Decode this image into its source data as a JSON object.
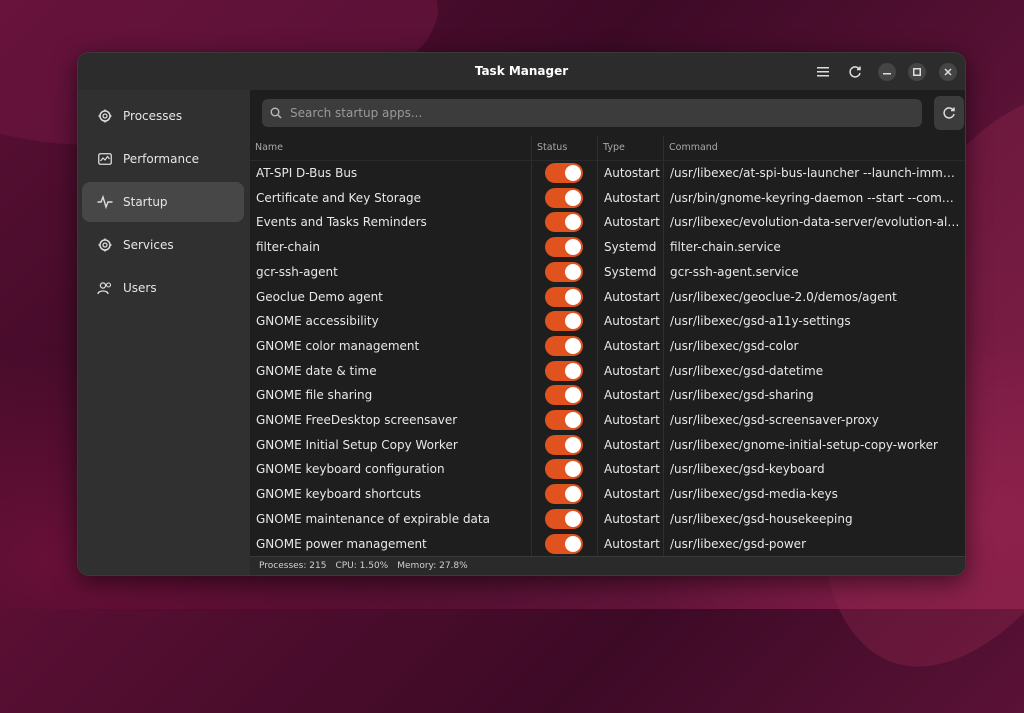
{
  "window": {
    "title": "Task Manager"
  },
  "sidebar": {
    "items": [
      {
        "label": "Processes",
        "icon": "gear-icon",
        "active": false
      },
      {
        "label": "Performance",
        "icon": "chart-icon",
        "active": false
      },
      {
        "label": "Startup",
        "icon": "startup-icon",
        "active": true
      },
      {
        "label": "Services",
        "icon": "gear-icon",
        "active": false
      },
      {
        "label": "Users",
        "icon": "users-icon",
        "active": false
      }
    ]
  },
  "search": {
    "placeholder": "Search startup apps..."
  },
  "table": {
    "columns": [
      "Name",
      "Status",
      "Type",
      "Command"
    ],
    "rows": [
      {
        "name": "AT-SPI D-Bus Bus",
        "enabled": true,
        "type": "Autostart",
        "command": "/usr/libexec/at-spi-bus-launcher --launch-immediately"
      },
      {
        "name": "Certificate and Key Storage",
        "enabled": true,
        "type": "Autostart",
        "command": "/usr/bin/gnome-keyring-daemon --start --compone…"
      },
      {
        "name": "Events and Tasks Reminders",
        "enabled": true,
        "type": "Autostart",
        "command": "/usr/libexec/evolution-data-server/evolution-alarm-…"
      },
      {
        "name": "filter-chain",
        "enabled": true,
        "type": "Systemd",
        "command": "filter-chain.service"
      },
      {
        "name": "gcr-ssh-agent",
        "enabled": true,
        "type": "Systemd",
        "command": "gcr-ssh-agent.service"
      },
      {
        "name": "Geoclue Demo agent",
        "enabled": true,
        "type": "Autostart",
        "command": "/usr/libexec/geoclue-2.0/demos/agent"
      },
      {
        "name": "GNOME accessibility",
        "enabled": true,
        "type": "Autostart",
        "command": "/usr/libexec/gsd-a11y-settings"
      },
      {
        "name": "GNOME color management",
        "enabled": true,
        "type": "Autostart",
        "command": "/usr/libexec/gsd-color"
      },
      {
        "name": "GNOME date & time",
        "enabled": true,
        "type": "Autostart",
        "command": "/usr/libexec/gsd-datetime"
      },
      {
        "name": "GNOME file sharing",
        "enabled": true,
        "type": "Autostart",
        "command": "/usr/libexec/gsd-sharing"
      },
      {
        "name": "GNOME FreeDesktop screensaver",
        "enabled": true,
        "type": "Autostart",
        "command": "/usr/libexec/gsd-screensaver-proxy"
      },
      {
        "name": "GNOME Initial Setup Copy Worker",
        "enabled": true,
        "type": "Autostart",
        "command": "/usr/libexec/gnome-initial-setup-copy-worker"
      },
      {
        "name": "GNOME keyboard configuration",
        "enabled": true,
        "type": "Autostart",
        "command": "/usr/libexec/gsd-keyboard"
      },
      {
        "name": "GNOME keyboard shortcuts",
        "enabled": true,
        "type": "Autostart",
        "command": "/usr/libexec/gsd-media-keys"
      },
      {
        "name": "GNOME maintenance of expirable data",
        "enabled": true,
        "type": "Autostart",
        "command": "/usr/libexec/gsd-housekeeping"
      },
      {
        "name": "GNOME power management",
        "enabled": true,
        "type": "Autostart",
        "command": "/usr/libexec/gsd-power"
      }
    ]
  },
  "status": {
    "processes": "Processes: 215",
    "cpu": "CPU: 1.50%",
    "memory": "Memory: 27.8%"
  },
  "colors": {
    "accent": "#e0531f",
    "window_bg": "#1e1e1e",
    "sidebar_bg": "#303030"
  }
}
